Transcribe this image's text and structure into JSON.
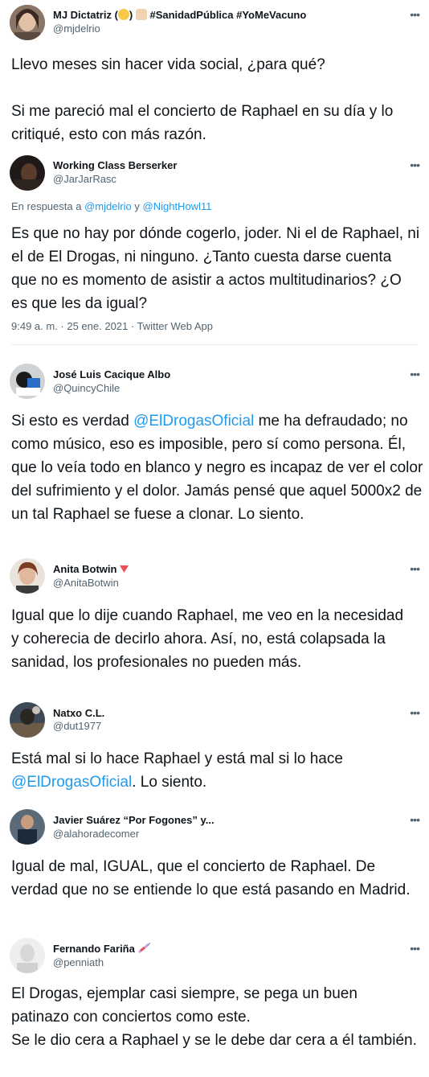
{
  "tweets": [
    {
      "name": "MJ Dictatriz (",
      "name_suffix": ") ",
      "hashtags": " #SanidadPública #YoMeVacuno",
      "handle": "@mjdelrio",
      "more_icon": "more-horizontal-icon",
      "text": "Llevo meses sin hacer vida social, ¿para qué?\n\nSi me pareció mal el concierto de Raphael en su día y lo critiqué, esto con más razón."
    },
    {
      "name": "Working Class Berserker",
      "handle": "@JarJarRasc",
      "reply_prefix": "En respuesta a ",
      "reply_user1": "@mjdelrio",
      "reply_and": " y ",
      "reply_user2": "@NightHowl11",
      "text": "Es que no hay por dónde cogerlo, joder. Ni el de Raphael, ni el de El Drogas, ni ninguno. ¿Tanto cuesta darse cuenta que no es momento de asistir a actos multitudinarios? ¿O es que les da igual?",
      "time": "9:49 a. m. · 25 ene. 2021 · Twitter Web App"
    },
    {
      "name": "José Luis Cacique Albo",
      "handle": "@QuincyChile",
      "text_pre": "Si esto es verdad ",
      "mention": "@ElDrogasOficial",
      "text_post": " me ha defraudado; no como músico, eso es imposible, pero sí como persona. Él, que lo veía todo en blanco y negro es incapaz de ver el color del sufrimiento y el dolor. Jamás pensé que aquel 5000x2 de un tal Raphael se fuese a clonar. Lo siento."
    },
    {
      "name": "Anita Botwin",
      "handle": "@AnitaBotwin",
      "text": "Igual que lo dije cuando Raphael, me veo en la necesidad y coherecia de decirlo ahora. Así, no, está colapsada la sanidad, los profesionales no pueden más."
    },
    {
      "name": "Natxo C.L.",
      "handle": "@dut1977",
      "text_pre": "Está mal si lo hace Raphael y está mal si lo hace ",
      "mention": "@ElDrogasOficial",
      "text_post": ". Lo siento."
    },
    {
      "name": "Javier Suárez “Por Fogones” y...",
      "handle": "@alahoradecomer",
      "text": "Igual de mal, IGUAL, que el concierto de Raphael. De verdad que no se entiende lo que está pasando en Madrid."
    },
    {
      "name": "Fernando Fariña",
      "handle": "@penniath",
      "text": "El Drogas, ejemplar casi siempre, se pega un buen patinazo con conciertos como este.\nSe le dio cera a Raphael y se le debe dar cera a él también."
    }
  ],
  "colors": {
    "link": "#1d9bf0",
    "secondary": "#536471",
    "divider": "#e6ecf0"
  }
}
